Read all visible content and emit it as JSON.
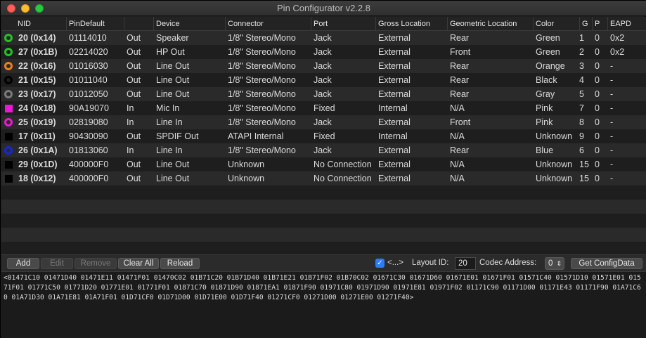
{
  "window": {
    "title": "Pin Configurator v2.2.8"
  },
  "columns": [
    "NID",
    "PinDefault",
    "",
    "Device",
    "Connector",
    "Port",
    "Gross Location",
    "Geometric Location",
    "Color",
    "G",
    "P",
    "EAPD"
  ],
  "rows": [
    {
      "nid": "20 (0x14)",
      "pindefault": "01114010",
      "dir": "Out",
      "device": "Speaker",
      "connector": "1/8\" Stereo/Mono",
      "port": "Jack",
      "gross": "External",
      "geo": "Rear",
      "color": "Green",
      "g": "1",
      "p": "0",
      "eapd": "0x2",
      "swatch": "#22c322",
      "shape": "ring"
    },
    {
      "nid": "27 (0x1B)",
      "pindefault": "02214020",
      "dir": "Out",
      "device": "HP Out",
      "connector": "1/8\" Stereo/Mono",
      "port": "Jack",
      "gross": "External",
      "geo": "Front",
      "color": "Green",
      "g": "2",
      "p": "0",
      "eapd": "0x2",
      "swatch": "#22c322",
      "shape": "ring"
    },
    {
      "nid": "22 (0x16)",
      "pindefault": "01016030",
      "dir": "Out",
      "device": "Line Out",
      "connector": "1/8\" Stereo/Mono",
      "port": "Jack",
      "gross": "External",
      "geo": "Rear",
      "color": "Orange",
      "g": "3",
      "p": "0",
      "eapd": "-",
      "swatch": "#f07f15",
      "shape": "ring"
    },
    {
      "nid": "21 (0x15)",
      "pindefault": "01011040",
      "dir": "Out",
      "device": "Line Out",
      "connector": "1/8\" Stereo/Mono",
      "port": "Jack",
      "gross": "External",
      "geo": "Rear",
      "color": "Black",
      "g": "4",
      "p": "0",
      "eapd": "-",
      "swatch": "#000000",
      "shape": "ring"
    },
    {
      "nid": "23 (0x17)",
      "pindefault": "01012050",
      "dir": "Out",
      "device": "Line Out",
      "connector": "1/8\" Stereo/Mono",
      "port": "Jack",
      "gross": "External",
      "geo": "Rear",
      "color": "Gray",
      "g": "5",
      "p": "0",
      "eapd": "-",
      "swatch": "#7a7a7a",
      "shape": "ring"
    },
    {
      "nid": "24 (0x18)",
      "pindefault": "90A19070",
      "dir": "In",
      "device": "Mic In",
      "connector": "1/8\" Stereo/Mono",
      "port": "Fixed",
      "gross": "Internal",
      "geo": "N/A",
      "color": "Pink",
      "g": "7",
      "p": "0",
      "eapd": "-",
      "swatch": "#e81ad6",
      "shape": "square"
    },
    {
      "nid": "25 (0x19)",
      "pindefault": "02819080",
      "dir": "In",
      "device": "Line In",
      "connector": "1/8\" Stereo/Mono",
      "port": "Jack",
      "gross": "External",
      "geo": "Front",
      "color": "Pink",
      "g": "8",
      "p": "0",
      "eapd": "-",
      "swatch": "#e81ad6",
      "shape": "ring"
    },
    {
      "nid": "17 (0x11)",
      "pindefault": "90430090",
      "dir": "Out",
      "device": "SPDIF Out",
      "connector": "ATAPI Internal",
      "port": "Fixed",
      "gross": "Internal",
      "geo": "N/A",
      "color": "Unknown",
      "g": "9",
      "p": "0",
      "eapd": "-",
      "swatch": "#000000",
      "shape": "square"
    },
    {
      "nid": "26 (0x1A)",
      "pindefault": "01813060",
      "dir": "In",
      "device": "Line In",
      "connector": "1/8\" Stereo/Mono",
      "port": "Jack",
      "gross": "External",
      "geo": "Rear",
      "color": "Blue",
      "g": "6",
      "p": "0",
      "eapd": "-",
      "swatch": "#1426e0",
      "shape": "ring"
    },
    {
      "nid": "29 (0x1D)",
      "pindefault": "400000F0",
      "dir": "Out",
      "device": "Line Out",
      "connector": "Unknown",
      "port": "No Connection",
      "gross": "External",
      "geo": "N/A",
      "color": "Unknown",
      "g": "15",
      "p": "0",
      "eapd": "-",
      "swatch": "#000000",
      "shape": "square"
    },
    {
      "nid": "18 (0x12)",
      "pindefault": "400000F0",
      "dir": "Out",
      "device": "Line Out",
      "connector": "Unknown",
      "port": "No Connection",
      "gross": "External",
      "geo": "N/A",
      "color": "Unknown",
      "g": "15",
      "p": "0",
      "eapd": "-",
      "swatch": "#000000",
      "shape": "square"
    }
  ],
  "toolbar": {
    "add": "Add",
    "edit": "Edit",
    "remove": "Remove",
    "clear_all": "Clear All",
    "reload": "Reload",
    "checkbox_label": "<...>",
    "layout_id_label": "Layout ID:",
    "layout_id_value": "20",
    "codec_address_label": "Codec Address:",
    "codec_address_value": "0",
    "get_config": "Get ConfigData"
  },
  "output": "<01471C10 01471D40 01471E11 01471F01 01470C02 01B71C20 01B71D40 01B71E21 01B71F02 01B70C02 01671C30 01671D60 01671E01 01671F01 01571C40 01571D10 01571E01 01571F01 01771C50 01771D20 01771E01 01771F01 01871C70 01871D90 01871EA1 01871F90 01971C80 01971D90 01971E81 01971F02 01171C90 01171D00 01171E43 01171F90 01A71C60 01A71D30 01A71E81 01A71F01 01D71CF0 01D71D00 01D71E00 01D71F40 01271CF0 01271D00 01271E00 01271F40>"
}
